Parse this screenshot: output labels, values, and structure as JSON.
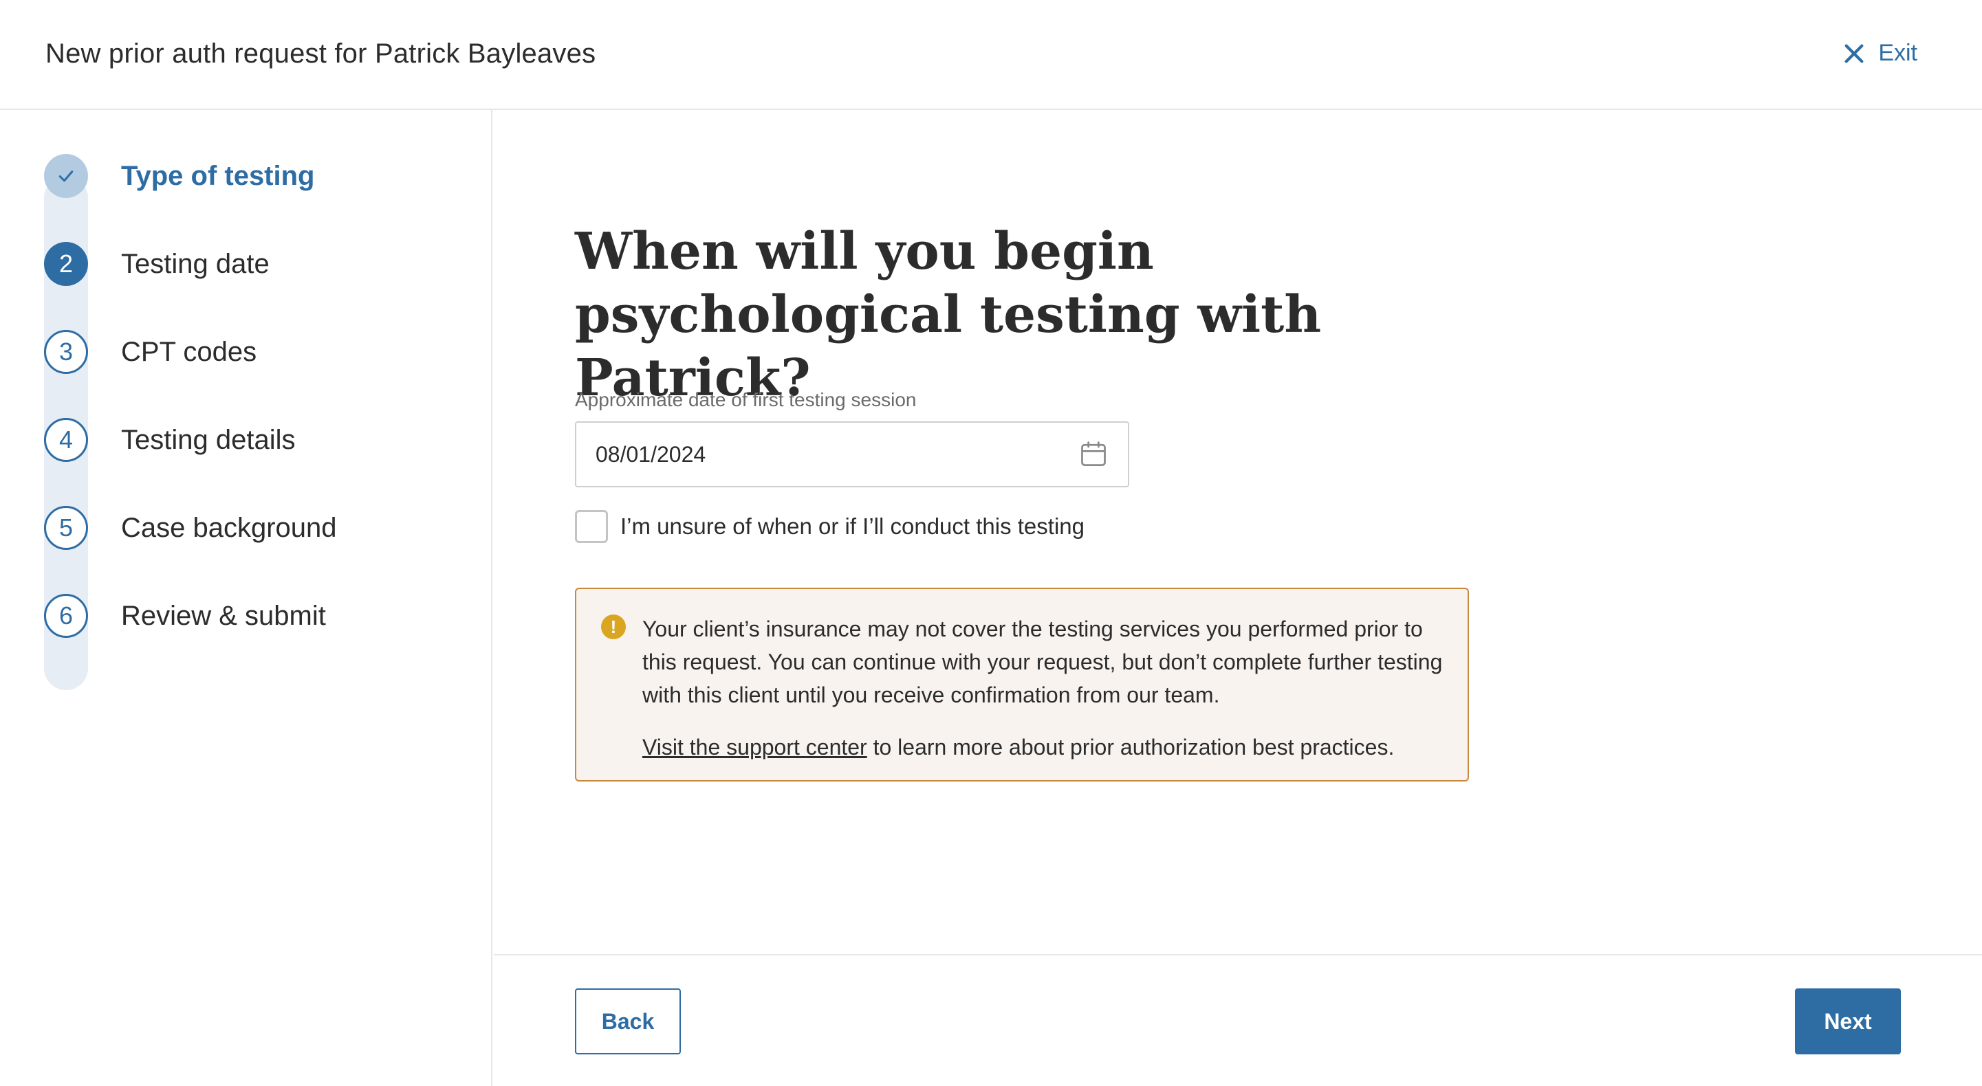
{
  "header": {
    "title": "New prior auth request for Patrick Bayleaves",
    "exit_label": "Exit",
    "exit_icon": "close-icon"
  },
  "steps": [
    {
      "marker": "",
      "label": "Type of testing",
      "state": "done"
    },
    {
      "marker": "2",
      "label": "Testing date",
      "state": "active"
    },
    {
      "marker": "3",
      "label": "CPT codes",
      "state": "todo"
    },
    {
      "marker": "4",
      "label": "Testing details",
      "state": "todo"
    },
    {
      "marker": "5",
      "label": "Case background",
      "state": "todo"
    },
    {
      "marker": "6",
      "label": "Review & submit",
      "state": "todo"
    }
  ],
  "main": {
    "question": "When will you begin psychological testing with Patrick?",
    "date_field": {
      "label": "Approximate date of first testing session",
      "value": "08/01/2024",
      "icon": "calendar-icon"
    },
    "unsure_checkbox": {
      "label": "I’m unsure of when or if I’ll conduct this testing",
      "checked": false
    },
    "alert": {
      "icon": "warning-icon",
      "message": "Your client’s insurance may not cover the testing services you performed prior to this request. You can continue with your request, but don’t complete further testing with this client until you receive confirmation from our team.",
      "link_text": "Visit the support center",
      "link_suffix": " to learn more about prior authorization best practices."
    }
  },
  "footer": {
    "back_label": "Back",
    "next_label": "Next"
  },
  "colors": {
    "accent": "#2e6da4",
    "done_marker": "#b3cbe1",
    "track": "#e6edf4",
    "alert_border": "#c8893d",
    "alert_bg": "#f8f3ef",
    "warning_icon": "#daa520"
  }
}
